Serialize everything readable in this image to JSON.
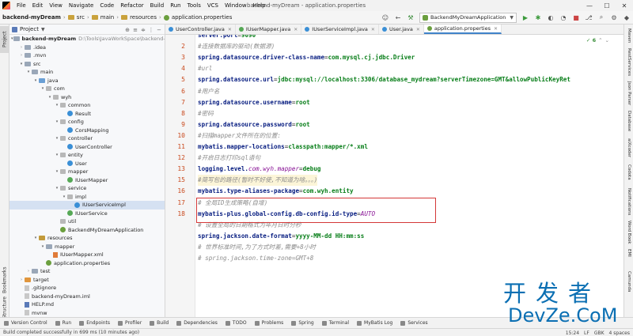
{
  "menubar": {
    "items": [
      "File",
      "Edit",
      "View",
      "Navigate",
      "Code",
      "Refactor",
      "Build",
      "Run",
      "Tools",
      "VCS",
      "Window",
      "Help"
    ],
    "window_title": "backend-myDream - application.properties"
  },
  "navbar": {
    "breadcrumbs": [
      "backend-myDream",
      "src",
      "main",
      "resources",
      "application.properties"
    ],
    "run_config": "BackendMyDreamApplication"
  },
  "project_panel": {
    "title": "Project",
    "tree": [
      {
        "label": "backend-myDream",
        "extra": "D:\\Tools\\JavaWorkSpace\\backend-m",
        "depth": 0,
        "arrow": "▾",
        "icon": "folder",
        "bold": true
      },
      {
        "label": ".idea",
        "extra": "",
        "depth": 1,
        "arrow": "›",
        "icon": "folder"
      },
      {
        "label": ".mvn",
        "extra": "",
        "depth": 1,
        "arrow": "›",
        "icon": "folder"
      },
      {
        "label": "src",
        "extra": "",
        "depth": 1,
        "arrow": "▾",
        "icon": "folder"
      },
      {
        "label": "main",
        "extra": "",
        "depth": 2,
        "arrow": "▾",
        "icon": "folder"
      },
      {
        "label": "java",
        "extra": "",
        "depth": 3,
        "arrow": "▾",
        "icon": "folder-src"
      },
      {
        "label": "com",
        "extra": "",
        "depth": 4,
        "arrow": "▾",
        "icon": "pkg"
      },
      {
        "label": "wyh",
        "extra": "",
        "depth": 5,
        "arrow": "▾",
        "icon": "pkg"
      },
      {
        "label": "common",
        "extra": "",
        "depth": 6,
        "arrow": "▾",
        "icon": "pkg"
      },
      {
        "label": "Result",
        "extra": "",
        "depth": 7,
        "arrow": "",
        "icon": "class"
      },
      {
        "label": "config",
        "extra": "",
        "depth": 6,
        "arrow": "▾",
        "icon": "pkg"
      },
      {
        "label": "CorsMapping",
        "extra": "",
        "depth": 7,
        "arrow": "",
        "icon": "class"
      },
      {
        "label": "controller",
        "extra": "",
        "depth": 6,
        "arrow": "▾",
        "icon": "pkg"
      },
      {
        "label": "UserController",
        "extra": "",
        "depth": 7,
        "arrow": "",
        "icon": "class"
      },
      {
        "label": "entity",
        "extra": "",
        "depth": 6,
        "arrow": "▾",
        "icon": "pkg"
      },
      {
        "label": "User",
        "extra": "",
        "depth": 7,
        "arrow": "",
        "icon": "class"
      },
      {
        "label": "mapper",
        "extra": "",
        "depth": 6,
        "arrow": "▾",
        "icon": "pkg"
      },
      {
        "label": "IUserMapper",
        "extra": "",
        "depth": 7,
        "arrow": "",
        "icon": "iface"
      },
      {
        "label": "service",
        "extra": "",
        "depth": 6,
        "arrow": "▾",
        "icon": "pkg"
      },
      {
        "label": "impl",
        "extra": "",
        "depth": 7,
        "arrow": "▾",
        "icon": "pkg"
      },
      {
        "label": "IUserServiceImpl",
        "extra": "",
        "depth": 8,
        "arrow": "",
        "icon": "class",
        "selected": true
      },
      {
        "label": "IUserService",
        "extra": "",
        "depth": 7,
        "arrow": "",
        "icon": "iface"
      },
      {
        "label": "util",
        "extra": "",
        "depth": 6,
        "arrow": "",
        "icon": "pkg"
      },
      {
        "label": "BackendMyDreamApplication",
        "extra": "",
        "depth": 6,
        "arrow": "",
        "icon": "spring"
      },
      {
        "label": "resources",
        "extra": "",
        "depth": 3,
        "arrow": "▾",
        "icon": "folder-res"
      },
      {
        "label": "mapper",
        "extra": "",
        "depth": 4,
        "arrow": "▾",
        "icon": "folder"
      },
      {
        "label": "IUserMapper.xml",
        "extra": "",
        "depth": 5,
        "arrow": "",
        "icon": "xml"
      },
      {
        "label": "application.properties",
        "extra": "",
        "depth": 4,
        "arrow": "",
        "icon": "spring"
      },
      {
        "label": "test",
        "extra": "",
        "depth": 2,
        "arrow": "›",
        "icon": "folder"
      },
      {
        "label": "target",
        "extra": "",
        "depth": 1,
        "arrow": "›",
        "icon": "folder-orange"
      },
      {
        "label": ".gitignore",
        "extra": "",
        "depth": 1,
        "arrow": "",
        "icon": "file"
      },
      {
        "label": "backend-myDream.iml",
        "extra": "",
        "depth": 1,
        "arrow": "",
        "icon": "file"
      },
      {
        "label": "HELP.md",
        "extra": "",
        "depth": 1,
        "arrow": "",
        "icon": "md"
      },
      {
        "label": "mvnw",
        "extra": "",
        "depth": 1,
        "arrow": "",
        "icon": "file"
      }
    ]
  },
  "left_strip": [
    "Project",
    "Bookmarks",
    "Structure"
  ],
  "right_strip": [
    "Maven",
    "RestServices",
    "Json Parser",
    "Database",
    "aiXcoder",
    "Codota",
    "Notifications",
    "Word Book",
    "EMI",
    "Camunda"
  ],
  "tabs": [
    {
      "label": "UserController.java",
      "type": "class",
      "active": false
    },
    {
      "label": "IUserMapper.java",
      "type": "iface",
      "active": false
    },
    {
      "label": "IUserServiceImpl.java",
      "type": "class",
      "active": false
    },
    {
      "label": "User.java",
      "type": "class",
      "active": false
    },
    {
      "label": "application.properties",
      "type": "prop",
      "active": true
    }
  ],
  "editor": {
    "status": "✓ 6",
    "lines": [
      {
        "no": "",
        "parts": [
          [
            "k",
            "server.port"
          ],
          [
            "",
            "="
          ],
          [
            "v",
            "9090"
          ]
        ]
      },
      {
        "no": "2",
        "parts": [
          [
            "c",
            "#连接数据库的驱动(数据源)"
          ]
        ]
      },
      {
        "no": "3",
        "parts": [
          [
            "k",
            "spring.datasource.driver-class-name"
          ],
          [
            "",
            "="
          ],
          [
            "v",
            "com.mysql.cj.jdbc.Driver"
          ]
        ]
      },
      {
        "no": "4",
        "parts": [
          [
            "c",
            "#url"
          ]
        ]
      },
      {
        "no": "5",
        "parts": [
          [
            "k",
            "spring.datasource.url"
          ],
          [
            "",
            "="
          ],
          [
            "v",
            "jdbc:mysql://localhost:3306/database_mydream?serverTimezone=GMT&allowPublicKeyRet"
          ]
        ]
      },
      {
        "no": "6",
        "parts": [
          [
            "c",
            "#用户名"
          ]
        ]
      },
      {
        "no": "7",
        "parts": [
          [
            "k",
            "spring.datasource.username"
          ],
          [
            "",
            "="
          ],
          [
            "v",
            "root"
          ]
        ]
      },
      {
        "no": "8",
        "parts": [
          [
            "c",
            "#密码"
          ]
        ]
      },
      {
        "no": "9",
        "parts": [
          [
            "k",
            "spring.datasource.password"
          ],
          [
            "",
            "="
          ],
          [
            "v",
            "root"
          ]
        ]
      },
      {
        "no": "10",
        "parts": [
          [
            "c",
            "#扫描mapper文件所在的位置:"
          ]
        ]
      },
      {
        "no": "11",
        "parts": [
          [
            "k",
            "mybatis.mapper-locations"
          ],
          [
            "",
            "="
          ],
          [
            "v",
            "classpath:mapper/*.xml"
          ]
        ]
      },
      {
        "no": "12",
        "parts": [
          [
            "c",
            "#开启日志打印sql语句"
          ]
        ]
      },
      {
        "no": "13",
        "parts": [
          [
            "k",
            "logging.level."
          ],
          [
            "kv",
            "com.wyh.mapper"
          ],
          [
            "",
            "="
          ],
          [
            "v",
            "debug"
          ]
        ]
      },
      {
        "no": "15",
        "parts": [
          [
            "c",
            "#简写包的路径(暂时不好使,不知道为啥。。。)"
          ]
        ],
        "highlight": true
      },
      {
        "no": "16",
        "parts": [
          [
            "k",
            "mybatis.type-aliases-package"
          ],
          [
            "",
            "="
          ],
          [
            "v",
            "com.wyh.entity"
          ]
        ]
      },
      {
        "no": "17",
        "parts": [
          [
            "c",
            "# 全局ID生成策略(自增)"
          ]
        ]
      },
      {
        "no": "18",
        "parts": [
          [
            "k",
            "mybatis-plus.global-config.db-config.id-type"
          ],
          [
            "",
            "="
          ],
          [
            "kv",
            "AUTO"
          ]
        ]
      },
      {
        "no": "",
        "parts": [
          [
            "c",
            "# 设置全局的日期格式为年月日时分秒"
          ]
        ]
      },
      {
        "no": "",
        "parts": [
          [
            "k",
            "spring.jackson.date-format"
          ],
          [
            "",
            "="
          ],
          [
            "v",
            "yyyy-MM-dd HH:mm:ss"
          ]
        ]
      },
      {
        "no": "",
        "parts": [
          [
            "c",
            "# 世界标准时间,为了方式时差,需要+8小时"
          ]
        ]
      },
      {
        "no": "",
        "parts": [
          [
            "c",
            "# spring.jackson.time-zone=GMT+8"
          ]
        ]
      }
    ]
  },
  "bottom_tools": [
    "Version Control",
    "Run",
    "Endpoints",
    "Profiler",
    "Build",
    "Dependencies",
    "TODO",
    "Problems",
    "Spring",
    "Terminal",
    "MyBatis Log",
    "Services"
  ],
  "statusbar": {
    "message": "Build completed successfully in 699 ms (10 minutes ago)",
    "position": "15:24",
    "line_sep": "LF",
    "encoding": "GBK",
    "indent": "4 spaces"
  },
  "watermark": {
    "cn": "开发者",
    "en": "DevZe.CoM"
  }
}
